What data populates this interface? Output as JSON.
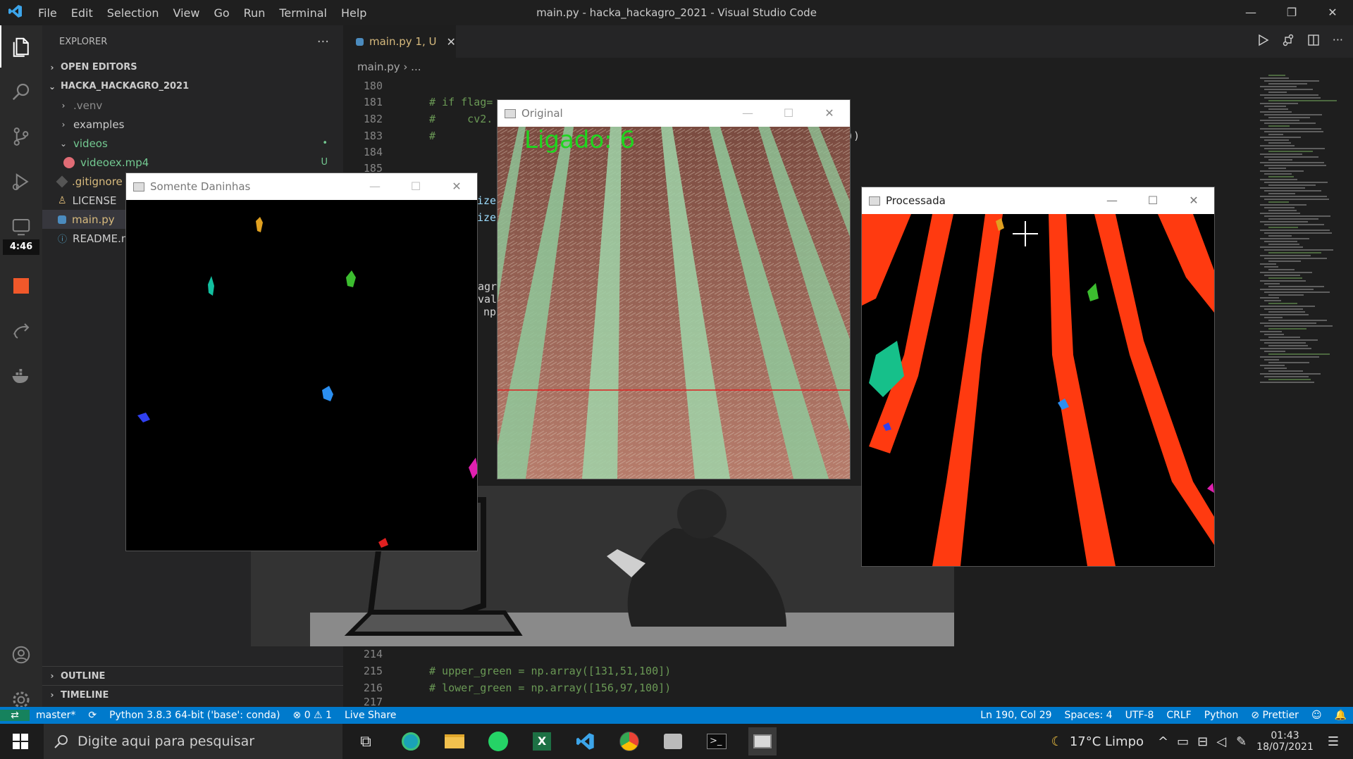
{
  "titlebar": {
    "menus": [
      "File",
      "Edit",
      "Selection",
      "View",
      "Go",
      "Run",
      "Terminal",
      "Help"
    ],
    "title": "main.py - hacka_hackagro_2021 - Visual Studio Code",
    "min": "—",
    "max": "❐",
    "close": "✕"
  },
  "activity": {
    "clock": "4:46"
  },
  "sidebar": {
    "header": "EXPLORER",
    "dots": "···",
    "open_editors": "OPEN EDITORS",
    "project": "HACKA_HACKAGRO_2021",
    "items": [
      ".venv",
      "examples",
      "videos",
      "videoex.mp4",
      ".gitignore",
      "LICENSE",
      "main.py",
      "README.m"
    ],
    "badges": {
      "videos": "•",
      "videoex": "U"
    },
    "outline": "OUTLINE",
    "timeline": "TIMELINE"
  },
  "editor": {
    "tab_label": "main.py 1, U",
    "tab_close": "✕",
    "breadcrumb": "main.py › ...",
    "lines_top": [
      {
        "n": "180",
        "c": ""
      },
      {
        "n": "181",
        "c": "# if flag="
      },
      {
        "n": "182",
        "c": "#     cv2."
      },
      {
        "n": "183",
        "c": "#"
      },
      {
        "n": "184",
        "c": ""
      },
      {
        "n": "185",
        "c": ""
      }
    ],
    "lines_bottom": [
      {
        "n": "214",
        "c": ""
      },
      {
        "n": "215",
        "c": "# upper_green = np.array([131,51,100])"
      },
      {
        "n": "216",
        "c": "# lower_green = np.array([156,97,100])"
      },
      {
        "n": "217",
        "c": ""
      }
    ],
    "fragments": [
      "ize",
      "ize",
      "agr",
      "valu",
      "np",
      "))"
    ]
  },
  "windows": {
    "original": {
      "title": "Original",
      "overlay": "Ligado: 6"
    },
    "daninhas": {
      "title": "Somente Daninhas"
    },
    "processada": {
      "title": "Processada"
    },
    "min": "—",
    "max": "☐",
    "close": "✕"
  },
  "statusbar": {
    "remote": "⇄",
    "branch": "master*",
    "sync": "⟳",
    "python": "Python 3.8.3 64-bit ('base': conda)",
    "problems": "⊗ 0 ⚠ 1",
    "liveshare": "Live Share",
    "position": "Ln 190, Col 29",
    "spaces": "Spaces: 4",
    "encoding": "UTF-8",
    "eol": "CRLF",
    "language": "Python",
    "prettier": "⊘ Prettier"
  },
  "taskbar": {
    "search_placeholder": "Digite aqui para pesquisar",
    "weather": "17°C  Limpo",
    "time": "01:43",
    "date": "18/07/2021"
  },
  "colors": {
    "accent": "#007acc",
    "crop_red": "#ff3a10",
    "weed_green": "#16c08a",
    "soil": "#9a5a4c",
    "plant": "#8fc89a"
  }
}
